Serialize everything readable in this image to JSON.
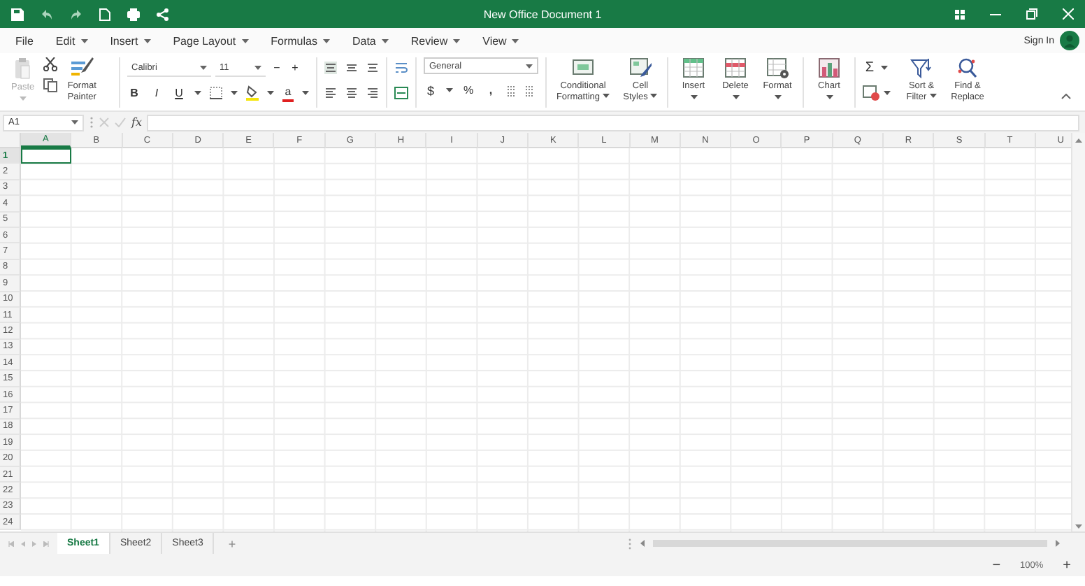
{
  "window": {
    "title": "New Office Document 1"
  },
  "menu": [
    {
      "label": "File",
      "has_menu": false
    },
    {
      "label": "Edit",
      "has_menu": true
    },
    {
      "label": "Insert",
      "has_menu": true
    },
    {
      "label": "Page Layout",
      "has_menu": true
    },
    {
      "label": "Formulas",
      "has_menu": true
    },
    {
      "label": "Data",
      "has_menu": true
    },
    {
      "label": "Review",
      "has_menu": true
    },
    {
      "label": "View",
      "has_menu": true
    }
  ],
  "account": {
    "label": "Sign In"
  },
  "ribbon": {
    "paste": {
      "label": "Paste",
      "disabled": true
    },
    "format_painter": "Format Painter",
    "font_name": "Calibri",
    "font_size": "11",
    "size_down": "−",
    "size_up": "+",
    "style_buttons": [
      "B",
      "I",
      "U"
    ],
    "font_color_label": "a",
    "number_format": "General",
    "number_buttons": [
      "$",
      "%",
      ","
    ],
    "sum_label": "Σ",
    "commands": [
      {
        "label": "Conditional Formatting",
        "kind": "inline_menu"
      },
      {
        "label": "Cell Styles",
        "kind": "inline_menu"
      },
      {
        "label": "Insert",
        "kind": "menu_below"
      },
      {
        "label": "Delete",
        "kind": "menu_below"
      },
      {
        "label": "Format",
        "kind": "menu_below"
      },
      {
        "label": "Chart",
        "kind": "menu_below"
      },
      {
        "label": "Sort & Filter",
        "kind": "inline_menu"
      },
      {
        "label": "Find & Replace",
        "kind": "plain"
      }
    ]
  },
  "formula_bar": {
    "name_box": "A1",
    "function_label": "fx"
  },
  "grid": {
    "columns": [
      {
        "label": "A",
        "selected": true
      },
      {
        "label": "B",
        "selected": false
      },
      {
        "label": "C",
        "selected": false
      },
      {
        "label": "D",
        "selected": false
      },
      {
        "label": "E",
        "selected": false
      },
      {
        "label": "F",
        "selected": false
      },
      {
        "label": "G",
        "selected": false
      },
      {
        "label": "H",
        "selected": false
      },
      {
        "label": "I",
        "selected": false
      },
      {
        "label": "J",
        "selected": false
      },
      {
        "label": "K",
        "selected": false
      },
      {
        "label": "L",
        "selected": false
      },
      {
        "label": "M",
        "selected": false
      },
      {
        "label": "N",
        "selected": false
      },
      {
        "label": "O",
        "selected": false
      },
      {
        "label": "P",
        "selected": false
      },
      {
        "label": "Q",
        "selected": false
      },
      {
        "label": "R",
        "selected": false
      },
      {
        "label": "S",
        "selected": false
      },
      {
        "label": "T",
        "selected": false
      },
      {
        "label": "U",
        "selected": false
      }
    ],
    "rows": [
      {
        "label": "1",
        "selected": true
      },
      {
        "label": "2",
        "selected": false
      },
      {
        "label": "3",
        "selected": false
      },
      {
        "label": "4",
        "selected": false
      },
      {
        "label": "5",
        "selected": false
      },
      {
        "label": "6",
        "selected": false
      },
      {
        "label": "7",
        "selected": false
      },
      {
        "label": "8",
        "selected": false
      },
      {
        "label": "9",
        "selected": false
      },
      {
        "label": "10",
        "selected": false
      },
      {
        "label": "11",
        "selected": false
      },
      {
        "label": "12",
        "selected": false
      },
      {
        "label": "13",
        "selected": false
      },
      {
        "label": "14",
        "selected": false
      },
      {
        "label": "15",
        "selected": false
      },
      {
        "label": "16",
        "selected": false
      },
      {
        "label": "17",
        "selected": false
      },
      {
        "label": "18",
        "selected": false
      },
      {
        "label": "19",
        "selected": false
      },
      {
        "label": "20",
        "selected": false
      },
      {
        "label": "21",
        "selected": false
      },
      {
        "label": "22",
        "selected": false
      },
      {
        "label": "23",
        "selected": false
      },
      {
        "label": "24",
        "selected": false
      }
    ]
  },
  "sheets": [
    {
      "label": "Sheet1",
      "selected": true
    },
    {
      "label": "Sheet2",
      "selected": false
    },
    {
      "label": "Sheet3",
      "selected": false
    }
  ],
  "add_sheet": "+",
  "status_bar": {
    "zoom_out": "−",
    "zoom": "100%",
    "zoom_in": "+"
  }
}
